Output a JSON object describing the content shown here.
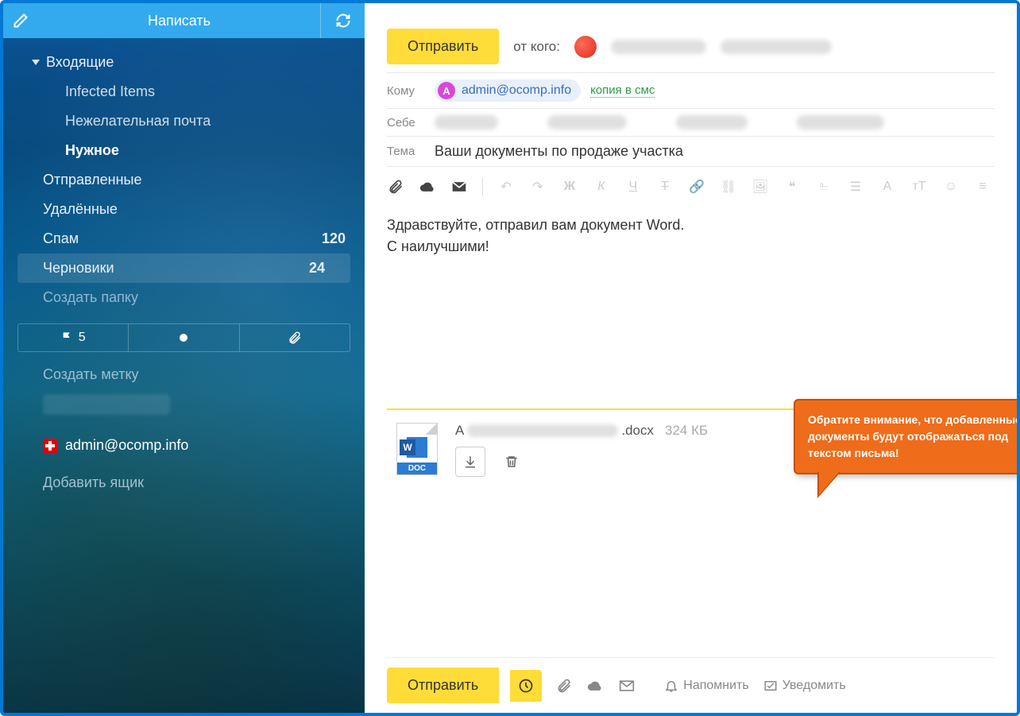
{
  "sidebar": {
    "compose": "Написать",
    "folders": {
      "inbox": "Входящие",
      "infected": "Infected Items",
      "junk": "Нежелательная почта",
      "important": "Нужное",
      "sent": "Отправленные",
      "deleted": "Удалённые",
      "spam": "Спам",
      "spam_count": "120",
      "drafts": "Черновики",
      "drafts_count": "24",
      "create_folder": "Создать папку"
    },
    "widgets": {
      "flag_count": "5"
    },
    "create_label": "Создать метку",
    "account_email": "admin@ocomp.info",
    "add_box": "Добавить ящик"
  },
  "compose": {
    "send": "Отправить",
    "from_label": "от кого:",
    "to_label": "Кому",
    "to_chip_initial": "А",
    "to_chip_email": "admin@ocomp.info",
    "sms_copy": "копия в смс",
    "self_label": "Себе",
    "subject_label": "Тема",
    "subject": "Ваши документы по продаже участка",
    "body_line1": "Здравствуйте, отправил вам документ Word.",
    "body_line2": "С наилучшими!",
    "callout": "Обратите внимание, что добавленные документы будут отображаться под текстом письма!",
    "attachment": {
      "name_prefix": "А",
      "ext": ".docx",
      "size": "324 КБ",
      "doc_label": "DOC"
    },
    "remind": "Напомнить",
    "notify": "Уведомить"
  }
}
